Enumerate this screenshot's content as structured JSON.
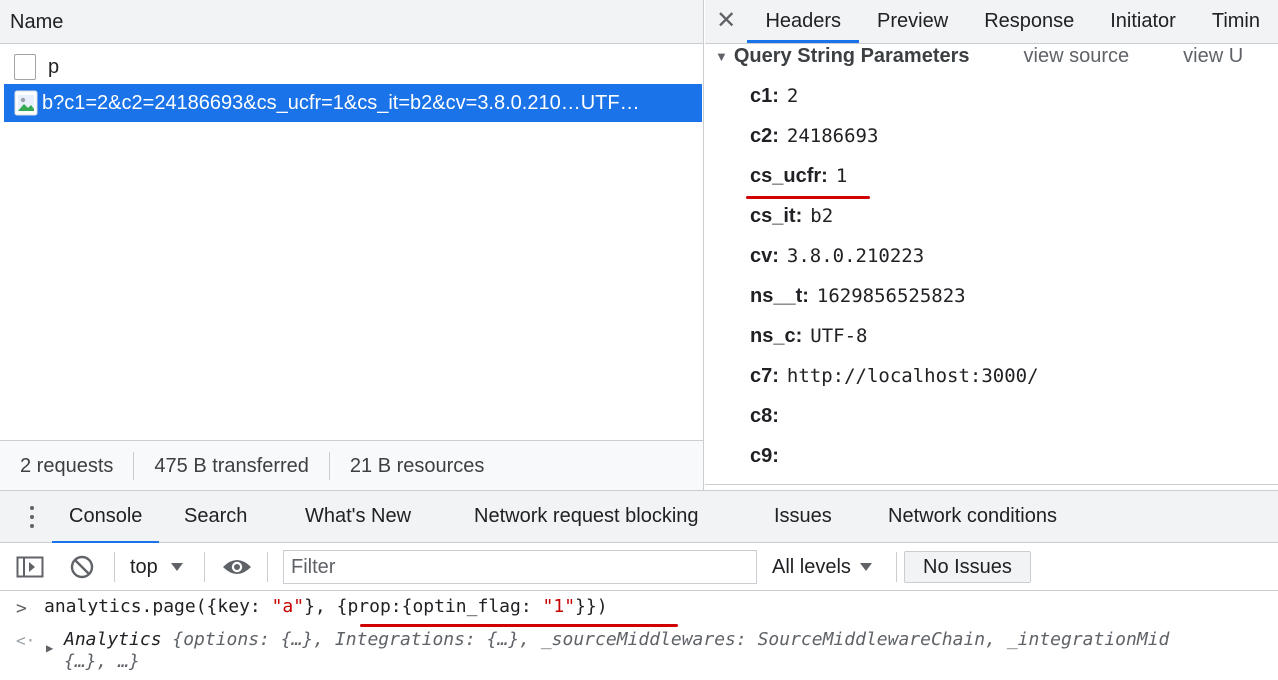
{
  "network": {
    "column_name": "Name",
    "requests": [
      {
        "name": "p",
        "type": "document"
      },
      {
        "name": "b?c1=2&c2=24186693&cs_ucfr=1&cs_it=b2&cv=3.8.0.210…UTF…",
        "type": "image"
      }
    ],
    "status": {
      "requests": "2 requests",
      "transferred": "475 B transferred",
      "resources": "21 B resources"
    }
  },
  "details": {
    "close_symbol": "✕",
    "tabs": [
      "Headers",
      "Preview",
      "Response",
      "Initiator",
      "Timin"
    ],
    "active_tab": "Headers",
    "section": {
      "toggle_symbol": "▼",
      "title": "Query String Parameters",
      "view_source": "view source",
      "view_url": "view U"
    },
    "params": [
      {
        "key": "c1:",
        "value": "2"
      },
      {
        "key": "c2:",
        "value": "24186693"
      },
      {
        "key": "cs_ucfr:",
        "value": "1"
      },
      {
        "key": "cs_it:",
        "value": "b2"
      },
      {
        "key": "cv:",
        "value": "3.8.0.210223"
      },
      {
        "key": "ns__t:",
        "value": "1629856525823"
      },
      {
        "key": "ns_c:",
        "value": "UTF-8"
      },
      {
        "key": "c7:",
        "value": "http://localhost:3000/"
      },
      {
        "key": "c8:",
        "value": ""
      },
      {
        "key": "c9:",
        "value": ""
      }
    ]
  },
  "drawer": {
    "tabs": [
      "Console",
      "Search",
      "What's New",
      "Network request blocking",
      "Issues",
      "Network conditions"
    ],
    "active_tab": "Console",
    "toolbar": {
      "context": "top",
      "filter_placeholder": "Filter",
      "levels": "All levels",
      "issues": "No Issues"
    }
  },
  "console": {
    "input_prompt": ">",
    "input": {
      "p1": "analytics.page({key: ",
      "s1": "\"a\"",
      "p2": "}, {prop:{optin_flag: ",
      "s2": "\"1\"",
      "p3": "}})"
    },
    "output_prompt": "<·",
    "output": {
      "class_name": "Analytics ",
      "line1": "{options: {…}, Integrations: {…}, _sourceMiddlewares: SourceMiddlewareChain, _integrationMid",
      "line2": "{…}, …}"
    }
  },
  "colors": {
    "accent": "#1a73e8",
    "annotation_red": "#d10000",
    "string_red": "#c80000"
  }
}
